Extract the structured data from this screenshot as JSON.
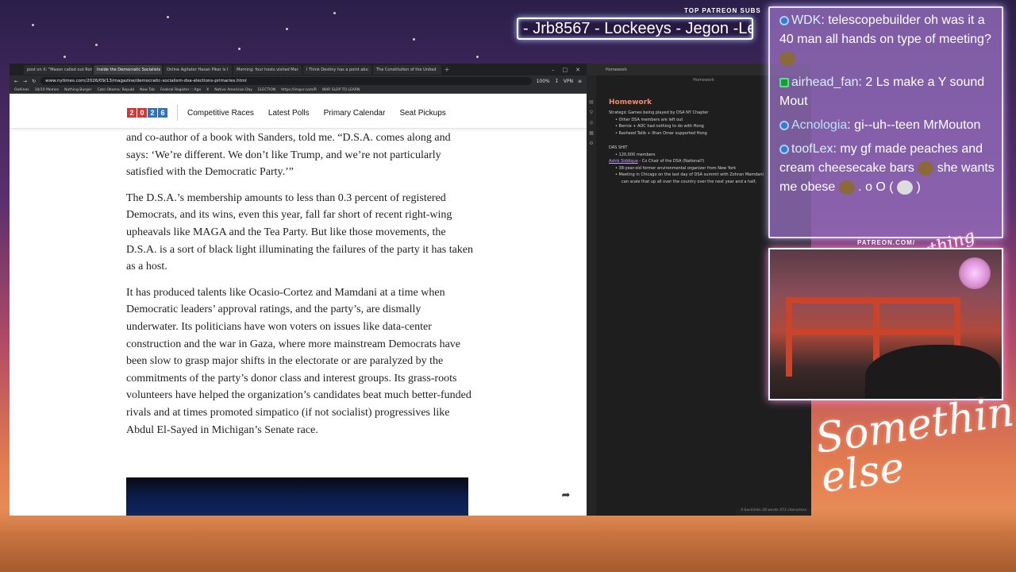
{
  "overlay": {
    "subs_label": "TOP PATREON SUBS",
    "subs_text": "- Jrb8567 - Lockeeys - Jegon -Le",
    "patreon_url": "PATREON.COM/",
    "brand_small": "Anything else?",
    "brand_script": "Something else"
  },
  "browser": {
    "tabs": [
      {
        "label": "post on X: \"Mason called out Ron"
      },
      {
        "label": "Inside the Democratic Socialists"
      },
      {
        "label": "Online Agitator Hasan Piker Is I"
      },
      {
        "label": "Morning: four hosts visited Mar"
      },
      {
        "label": "I Think Destiny has a point abo"
      },
      {
        "label": "The Constitution of the United"
      }
    ],
    "tab_add": "+",
    "url": "www.nytimes.com/2026/09/13/magazine/democratic-socialism-dsa-elections-primaries.html",
    "url_badge": "100%",
    "vpn_label": "VPN",
    "bookmarks": [
      "Outlines",
      "10/10 Memes",
      "Nothing Burger",
      "Cato Obama: Republ",
      "New Tab",
      "Federal Register :: Age",
      "X",
      "Native American Day",
      "ELECTION",
      "https://imgur.com/R",
      "WAR SLOP TO LEARN"
    ]
  },
  "nyt": {
    "logo_digits": [
      "2",
      "0",
      "2",
      "6"
    ],
    "logo_colors": [
      "#d0393a",
      "#d0393a",
      "#3173b9",
      "#3173b9"
    ],
    "nav_links": [
      "Competitive Races",
      "Latest Polls",
      "Primary Calendar",
      "Seat Pickups"
    ],
    "paragraphs": [
      "and co-author of a book with Sanders, told me. “D.S.A. comes along and says: ‘We’re different. We don’t like Trump, and we’re not particularly satisfied with the Democratic Party.’”",
      "The D.S.A.’s membership amounts to less than 0.3 percent of registered Democrats, and its wins, even this year, fall far short of recent right-wing upheavals like MAGA and the Tea Party. But like those movements, the D.S.A. is a sort of black light illuminating the failures of the party it has taken as a host.",
      "It has produced talents like Ocasio-Cortez and Mamdani at a time when Democratic leaders’ approval ratings, and the party’s, are dismally underwater. Its politicians have won voters on issues like data-center construction and the war in Gaza, where more mainstream Democrats have been slow to grasp major shifts in the electorate or are paralyzed by the commitments of the party’s donor class and interest groups. Its grass-roots volunteers have helped the organization’s candidates beat much better-funded rivals and at times promoted simpatico (if not socialist) progressives like Abdul El-Sayed in Michigan’s Senate race."
    ]
  },
  "notes": {
    "tab_label": "Homework",
    "header": "Homework",
    "title": "Homework",
    "line1": "Strategic Games being played by DSA NY Chapter",
    "bullets1": [
      "Other DSA members are left out",
      "Bernie + AOC had nothing to do with Hong",
      "Rasheed Talib + Ilhan Omar supported Hong"
    ],
    "section2": "DAS SHIT",
    "bullets2": [
      "120,000 members"
    ],
    "person_link": "Ashik Siddique",
    "person_desc": " - Co Chair of the DSA (National?)",
    "bullets3": [
      "38-year-old former environmental organizer from New York",
      "Meeting in Chicago on the last day of DSA summit with Zohran Mamdani",
      "can scale that up all over the country over the next year and a half,"
    ],
    "status": "0 backlinks   28 words   473 characters"
  },
  "chat": [
    {
      "user": "WDK",
      "text": ": telescopebuilder oh was it a 40 man all hands on type of meeting?",
      "badge": "b"
    },
    {
      "user": "airhead_fan",
      "text": ": 2 Ls make a Y sound Mout",
      "badge": "k"
    },
    {
      "user": "Acnologia",
      "text": ": gi--uh--teen MrMouton",
      "badge": "b"
    },
    {
      "user": "toofLex",
      "text": ": my gf made peaches and cream cheesecake bars",
      "badge": "b"
    }
  ],
  "chat_tail": "she wants me obese",
  "chat_tail2": ". o O (",
  "chat_tail3": ")"
}
